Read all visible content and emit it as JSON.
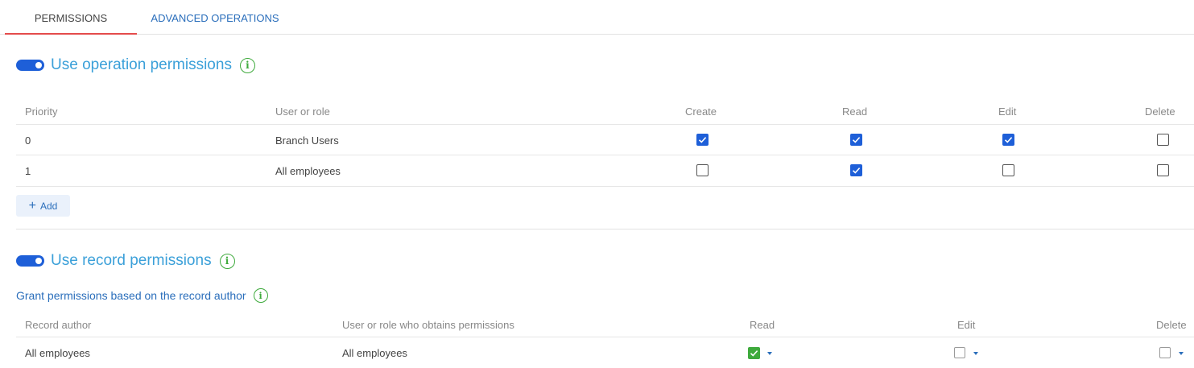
{
  "tabs": {
    "permissions": "PERMISSIONS",
    "advanced": "ADVANCED OPERATIONS"
  },
  "colors": {
    "accent_blue": "#1e5fd8",
    "title_blue": "#3ba0d9",
    "link_blue": "#2a6ebb",
    "info_green": "#3eaa3c",
    "active_tab_underline": "#e44c4c"
  },
  "operation_permissions": {
    "title": "Use operation permissions",
    "toggle_on": true,
    "columns": [
      "Priority",
      "User or role",
      "Create",
      "Read",
      "Edit",
      "Delete"
    ],
    "rows": [
      {
        "priority": "0",
        "role": "Branch Users",
        "create": true,
        "read": true,
        "edit": true,
        "delete": false
      },
      {
        "priority": "1",
        "role": "All employees",
        "create": false,
        "read": true,
        "edit": false,
        "delete": false
      }
    ],
    "add_label": "Add"
  },
  "record_permissions": {
    "title": "Use record permissions",
    "toggle_on": true,
    "subtitle": "Grant permissions based on the record author",
    "columns": [
      "Record author",
      "User or role who obtains permissions",
      "Read",
      "Edit",
      "Delete"
    ],
    "rows": [
      {
        "author": "All employees",
        "grantee": "All employees",
        "read": true,
        "edit": false,
        "delete": false
      }
    ]
  },
  "icons": {
    "info": "info-icon",
    "check": "checkmark-icon",
    "caret": "caret-down-icon",
    "plus": "plus-icon"
  }
}
